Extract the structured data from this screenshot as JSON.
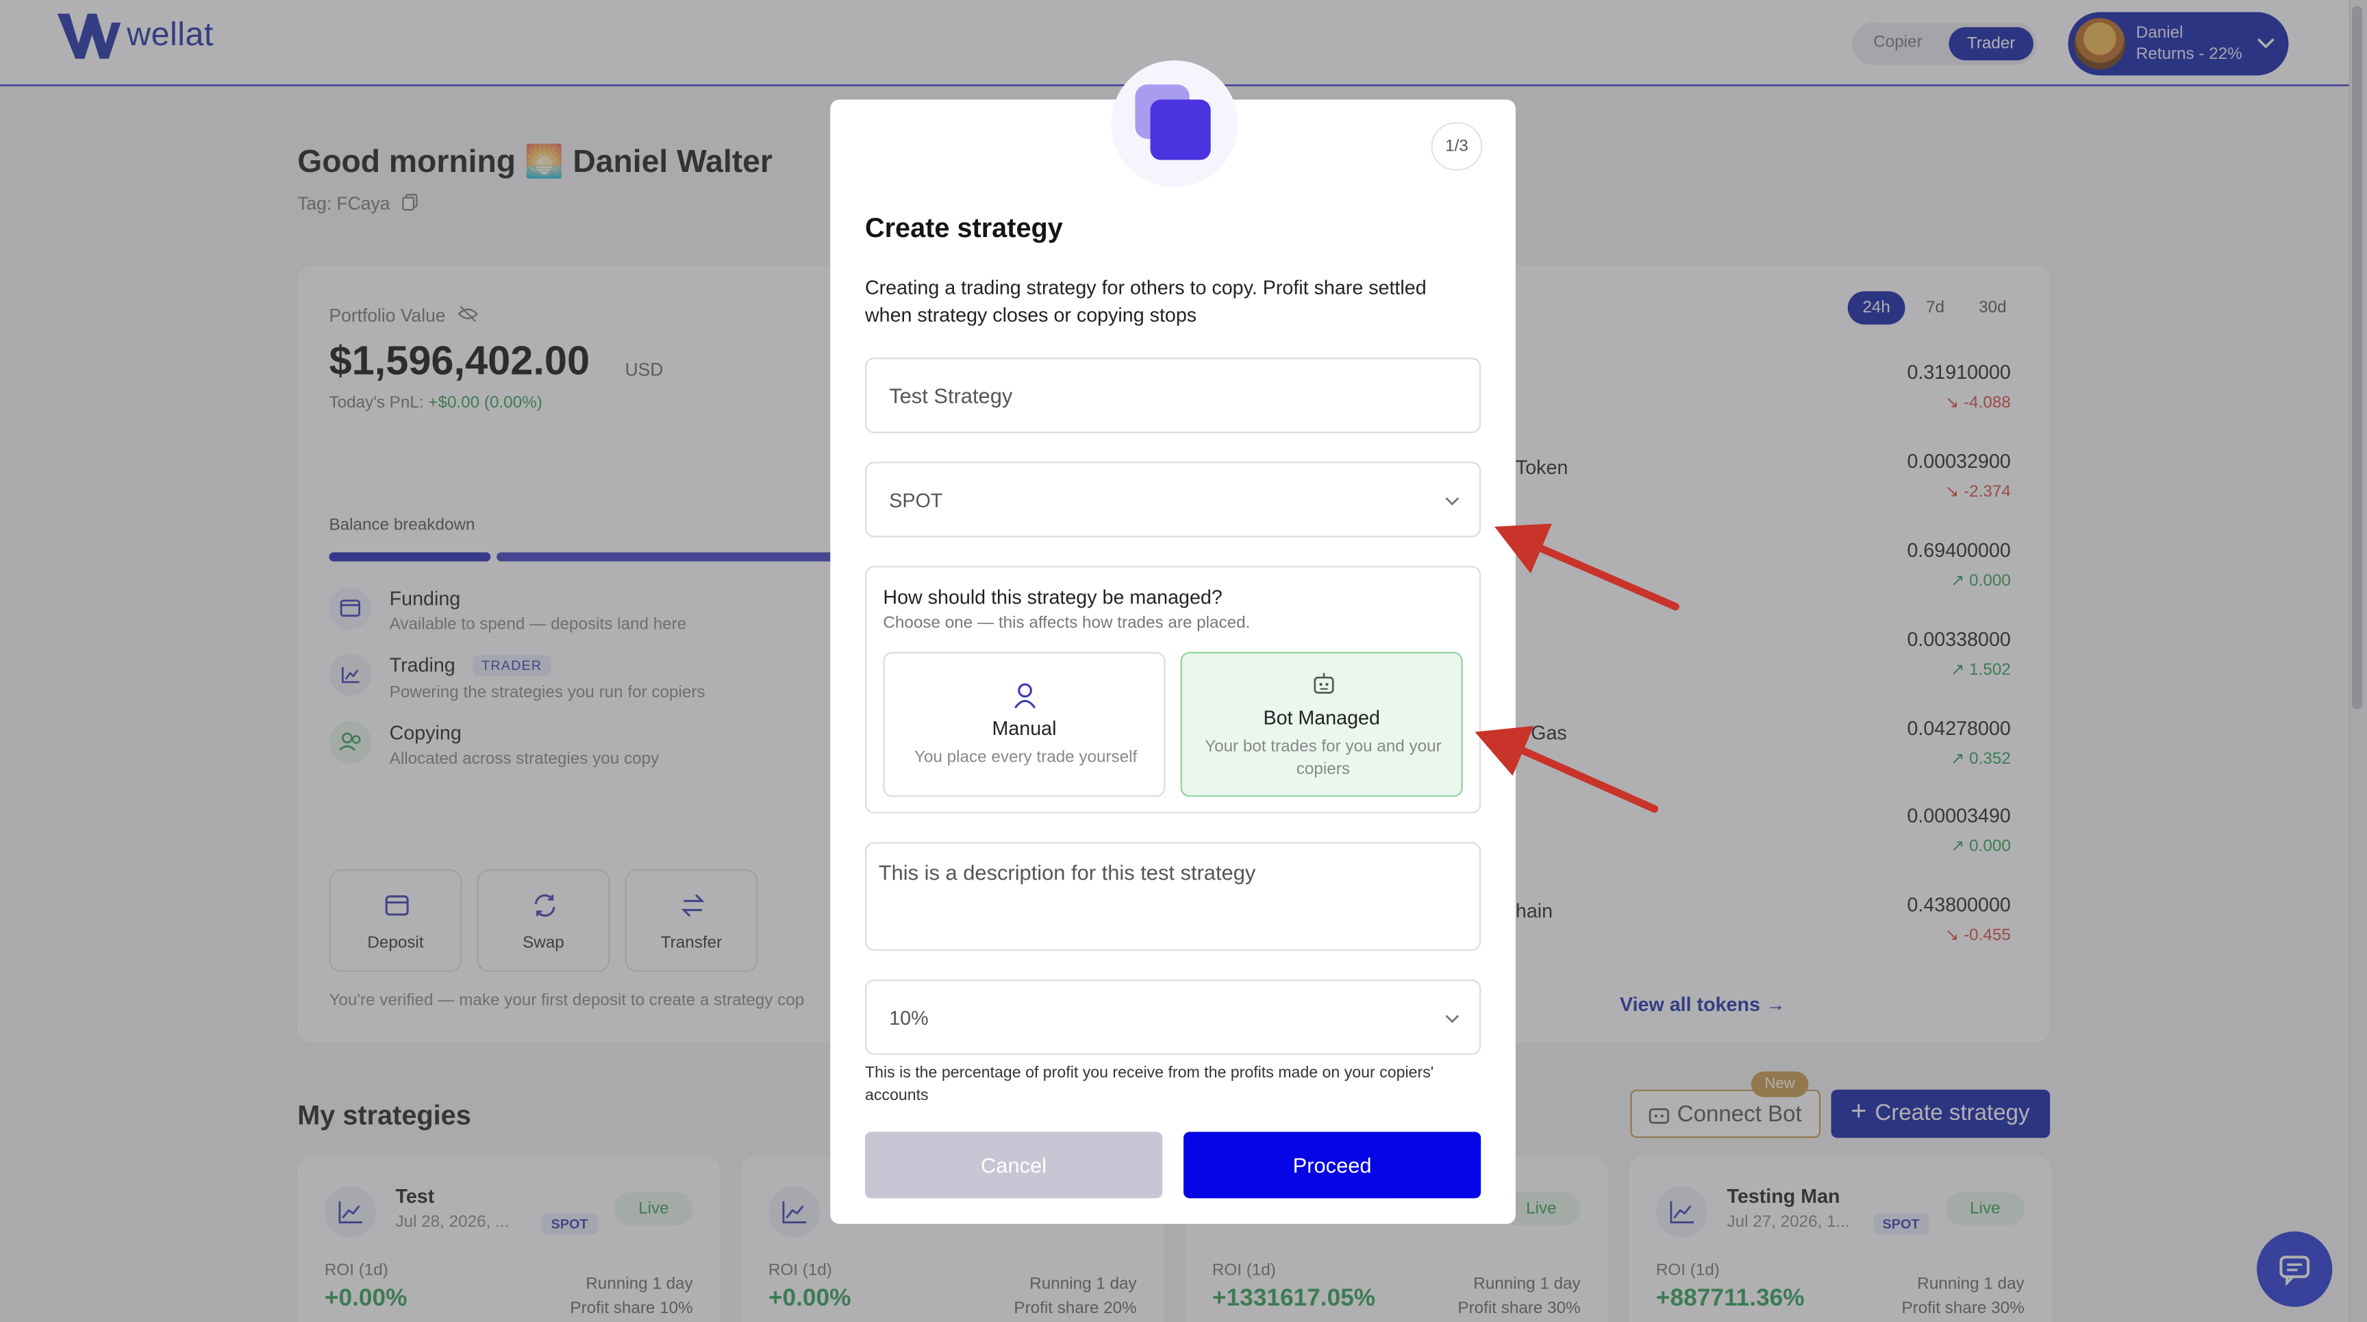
{
  "brand": {
    "name": "wellat"
  },
  "header": {
    "mode_copier": "Copier",
    "mode_trader": "Trader",
    "user_name": "Daniel",
    "user_returns": "Returns - 22%"
  },
  "greeting": {
    "title": "Good morning 🌅 Daniel Walter",
    "tag": "Tag: FCaya"
  },
  "portfolio": {
    "label": "Portfolio Value",
    "value": "$1,596,402.00",
    "currency": "USD",
    "pnl_label": "Today's PnL: ",
    "pnl_value": "+$0.00 (0.00%)",
    "breakdown_label": "Balance breakdown",
    "balances": [
      {
        "title": "Funding",
        "sub": "Available to spend — deposits land here"
      },
      {
        "title": "Trading",
        "badge": "TRADER",
        "sub": "Powering the strategies you run for copiers"
      },
      {
        "title": "Copying",
        "sub": "Allocated across strategies you copy"
      }
    ],
    "actions": [
      "Deposit",
      "Swap",
      "Transfer"
    ],
    "note": "You're verified — make your first deposit to create a strategy cop"
  },
  "tokens": {
    "periods": [
      "24h",
      "7d",
      "30d"
    ],
    "partial_names": [
      "Token",
      "y Gas",
      "hain"
    ],
    "rows": [
      {
        "value": "0.31910000",
        "change": "-4.088",
        "dir": "down"
      },
      {
        "value": "0.00032900",
        "change": "-2.374",
        "dir": "down"
      },
      {
        "value": "0.69400000",
        "change": "0.000",
        "dir": "up"
      },
      {
        "value": "0.00338000",
        "change": "1.502",
        "dir": "up"
      },
      {
        "value": "0.04278000",
        "change": "0.352",
        "dir": "up"
      },
      {
        "value": "0.00003490",
        "change": "0.000",
        "dir": "up"
      },
      {
        "value": "0.43800000",
        "change": "-0.455",
        "dir": "down"
      }
    ],
    "view_all": "View all tokens"
  },
  "strategies": {
    "title": "My strategies",
    "connect_bot": "Connect Bot",
    "new_badge": "New",
    "create": "Create strategy",
    "cards": [
      {
        "name": "Test",
        "date": "Jul 28, 2026, ...",
        "type": "SPOT",
        "status": "Live",
        "roi_label": "ROI (1d)",
        "roi": "+0.00%",
        "running": "Running 1 day",
        "share": "Profit share 10%"
      },
      {
        "name": "",
        "date": "",
        "type": "",
        "status": "",
        "roi_label": "ROI (1d)",
        "roi": "+0.00%",
        "running": "Running 1 day",
        "share": "Profit share 20%"
      },
      {
        "name": "",
        "date": "",
        "type": "",
        "status": "Live",
        "roi_label": "ROI (1d)",
        "roi": "+1331617.05%",
        "running": "Running 1 day",
        "share": "Profit share 30%"
      },
      {
        "name": "Testing Man",
        "date": "Jul 27, 2026, 1...",
        "type": "SPOT",
        "status": "Live",
        "roi_label": "ROI (1d)",
        "roi": "+887711.36%",
        "running": "Running 1 day",
        "share": "Profit share 30%"
      }
    ]
  },
  "modal": {
    "step": "1/3",
    "title": "Create strategy",
    "description": "Creating a trading strategy for others to copy. Profit share settled when strategy closes or copying stops",
    "name_value": "Test Strategy",
    "market_value": "SPOT",
    "manage_question": "How should this strategy be managed?",
    "manage_sub": "Choose one — this affects how trades are placed.",
    "options": [
      {
        "title": "Manual",
        "sub": "You place every trade yourself"
      },
      {
        "title": "Bot Managed",
        "sub": "Your bot trades for you and your copiers"
      }
    ],
    "description_value": "This is a description for this test strategy",
    "profit_share_value": "10%",
    "profit_share_help": "This is the percentage of profit you receive from the profits made on your copiers' accounts",
    "cancel": "Cancel",
    "proceed": "Proceed"
  },
  "colors": {
    "brand": "#0f1fa6",
    "primary_button": "#0505e6",
    "selected_option": "#eaf7ed",
    "annotation_arrow": "#c8342a"
  }
}
